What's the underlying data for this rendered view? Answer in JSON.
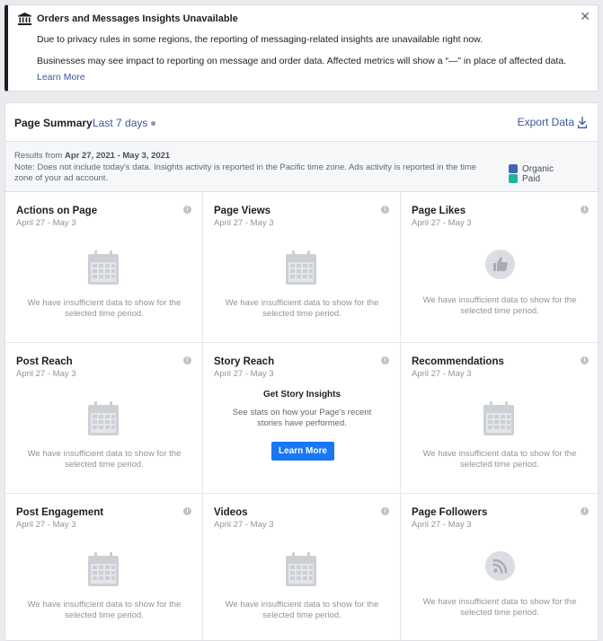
{
  "banner": {
    "title": "Orders and Messages Insights Unavailable",
    "line1": "Due to privacy rules in some regions, the reporting of messaging-related insights are unavailable right now.",
    "line2": "Businesses may see impact to reporting on message and order data. Affected metrics will show a “—” in place of affected data.",
    "learn_more": "Learn More",
    "close": "✕"
  },
  "summary": {
    "title": "Page Summary",
    "range": "Last 7 days",
    "export": "Export Data",
    "results_prefix": "Results from ",
    "results_range": "Apr 27, 2021 - May 3, 2021",
    "note": "Note: Does not include today's data. Insights activity is reported in the Pacific time zone. Ads activity is reported in the time zone of your ad account.",
    "legend": [
      {
        "label": "Organic",
        "color": "#4267b2"
      },
      {
        "label": "Paid",
        "color": "#20b39c"
      }
    ]
  },
  "colors": {
    "link": "#385898",
    "button": "#1877f2",
    "muted": "#90949c"
  },
  "cards": [
    {
      "title": "Actions on Page",
      "date": "April 27 - May 3",
      "icon": "calendar-icon",
      "message": "We have insufficient data to show for the selected time period."
    },
    {
      "title": "Page Views",
      "date": "April 27 - May 3",
      "icon": "calendar-icon",
      "message": "We have insufficient data to show for the selected time period."
    },
    {
      "title": "Page Likes",
      "date": "April 27 - May 3",
      "icon": "thumbs-up-icon",
      "message": "We have insufficient data to show for the selected time period."
    },
    {
      "title": "Post Reach",
      "date": "April 27 - May 3",
      "icon": "calendar-icon",
      "message": "We have insufficient data to show for the selected time period."
    },
    {
      "title": "Story Reach",
      "date": "April 27 - May 3",
      "cta_title": "Get Story Insights",
      "cta_text": "See stats on how your Page's recent stories have performed.",
      "cta_button": "Learn More"
    },
    {
      "title": "Recommendations",
      "date": "April 27 - May 3",
      "icon": "calendar-icon",
      "message": "We have insufficient data to show for the selected time period."
    },
    {
      "title": "Post Engagement",
      "date": "April 27 - May 3",
      "icon": "calendar-icon",
      "message": "We have insufficient data to show for the selected time period."
    },
    {
      "title": "Videos",
      "date": "April 27 - May 3",
      "icon": "calendar-icon",
      "message": "We have insufficient data to show for the selected time period."
    },
    {
      "title": "Page Followers",
      "date": "April 27 - May 3",
      "icon": "rss-icon",
      "message": "We have insufficient data to show for the selected time period."
    }
  ]
}
